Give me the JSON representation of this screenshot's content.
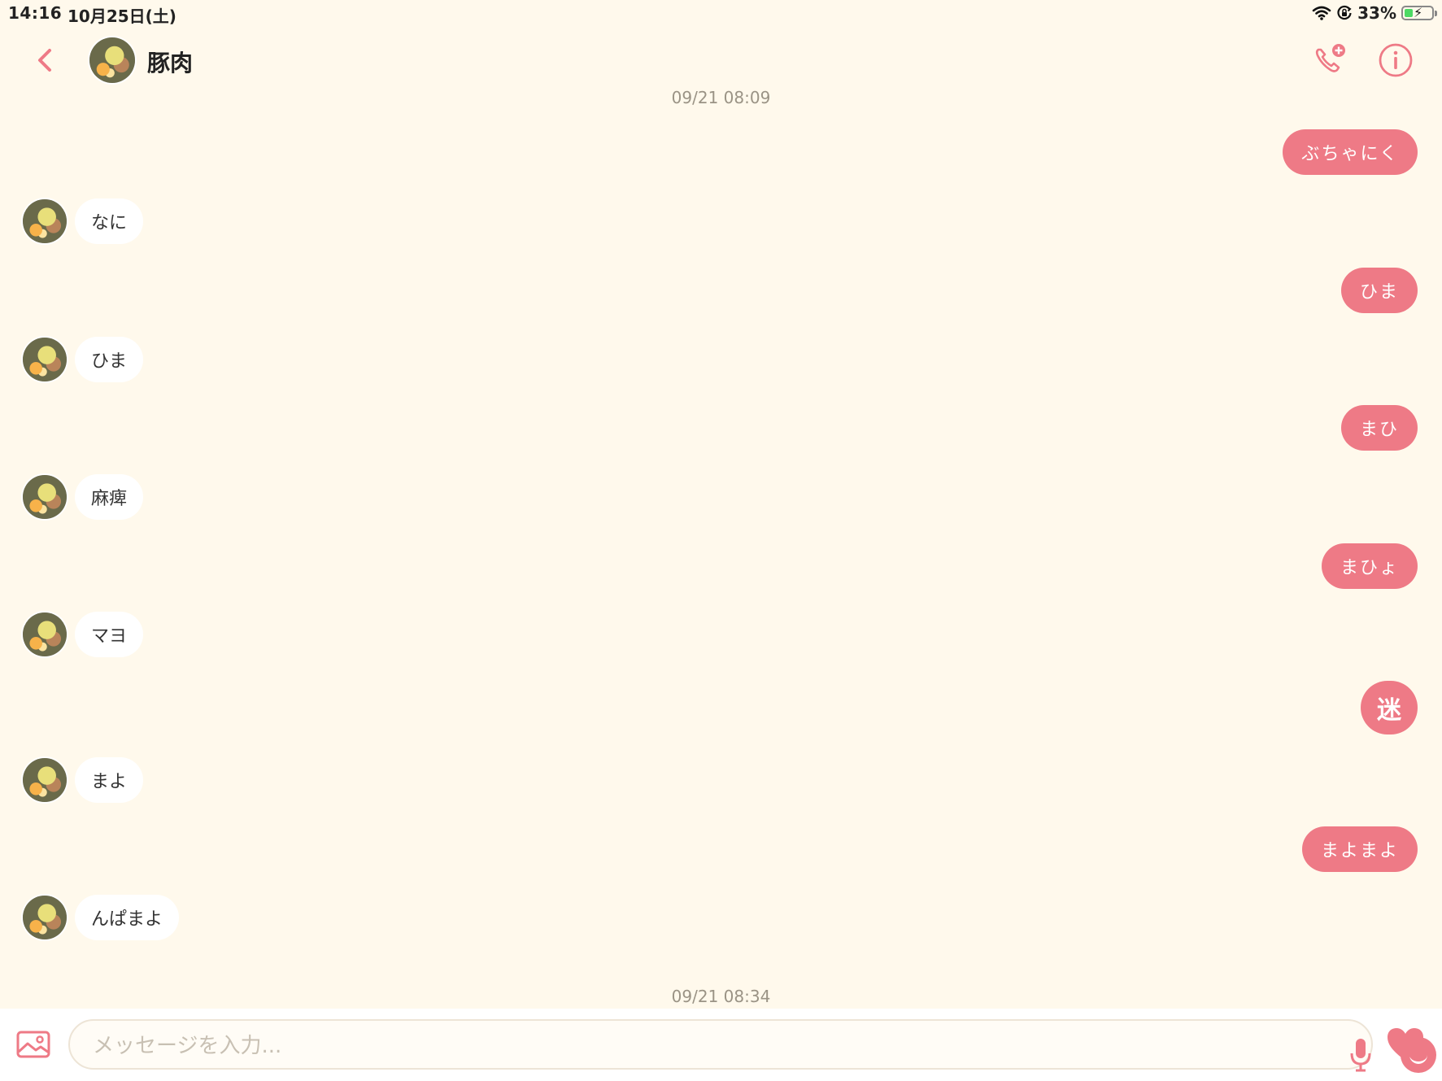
{
  "status_bar": {
    "time": "14:16",
    "date": "10月25日(土)",
    "battery": "33%"
  },
  "header": {
    "name": "豚肉"
  },
  "timestamps": [
    "09/21 08:09",
    "09/21 08:34"
  ],
  "messages": [
    {
      "dir": "out",
      "text": "ぶちゃにく"
    },
    {
      "dir": "in",
      "text": "なに"
    },
    {
      "dir": "out",
      "text": "ひま"
    },
    {
      "dir": "in",
      "text": "ひま"
    },
    {
      "dir": "out",
      "text": "まひ"
    },
    {
      "dir": "in",
      "text": "麻痺"
    },
    {
      "dir": "out",
      "text": "まひょ"
    },
    {
      "dir": "in",
      "text": "マヨ"
    },
    {
      "dir": "out",
      "text": "迷"
    },
    {
      "dir": "in",
      "text": "まよ"
    },
    {
      "dir": "out",
      "text": "まよまよ"
    },
    {
      "dir": "in",
      "text": "んぱまよ"
    }
  ],
  "input": {
    "placeholder": "メッセージを入力..."
  },
  "colors": {
    "accent": "#ee7a86",
    "background": "#fff9ec"
  }
}
